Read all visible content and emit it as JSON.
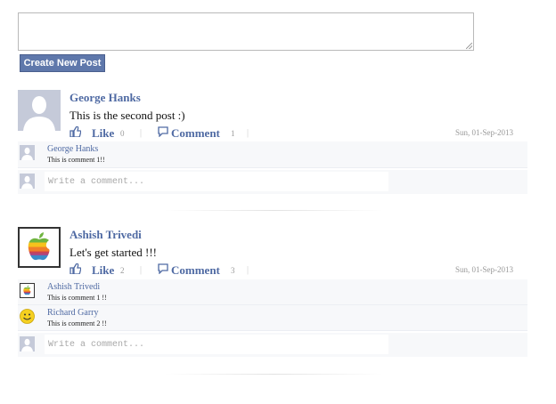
{
  "composer": {
    "placeholder": "",
    "value": ""
  },
  "create_button": {
    "label": "Create New Post"
  },
  "colors": {
    "accent": "#4f6aa3",
    "button_bg": "#5f78ab",
    "comment_bg": "#f7f8fa",
    "meta": "#999999"
  },
  "posts": [
    {
      "author": "George Hanks",
      "avatar_icon": "default-user-icon",
      "text": "This is the second post :)",
      "like_label": "Like",
      "like_count": "0",
      "comment_label": "Comment",
      "comment_count": "1",
      "separator": "|",
      "date": "Sun, 01-Sep-2013",
      "comments": [
        {
          "author": "George Hanks",
          "text": "This is comment 1!!",
          "avatar_icon": "default-user-icon"
        }
      ],
      "write_placeholder": "Write a comment..."
    },
    {
      "author": "Ashish Trivedi",
      "avatar_icon": "apple-logo-icon",
      "text": "Let's get started !!!",
      "like_label": "Like",
      "like_count": "2",
      "comment_label": "Comment",
      "comment_count": "3",
      "separator": "|",
      "date": "Sun, 01-Sep-2013",
      "comments": [
        {
          "author": "Ashish Trivedi",
          "text": "This is comment 1 !!",
          "avatar_icon": "apple-logo-icon"
        },
        {
          "author": "Richard Garry",
          "text": "This is comment 2 !!",
          "avatar_icon": "smiley-icon"
        }
      ],
      "write_placeholder": "Write a comment..."
    }
  ]
}
